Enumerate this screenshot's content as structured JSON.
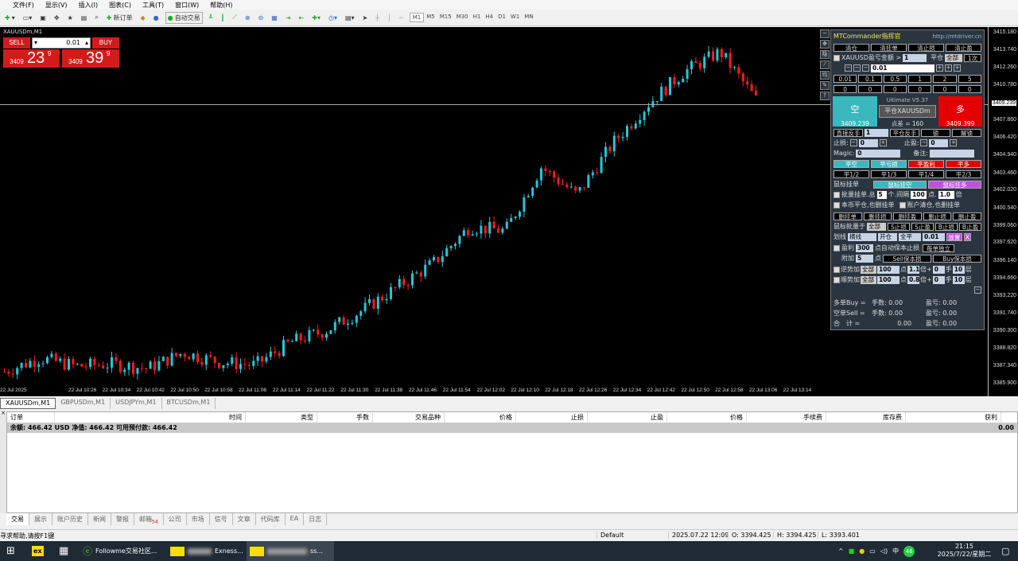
{
  "menu": [
    "文件(F)",
    "显示(V)",
    "插入(I)",
    "图表(C)",
    "工具(T)",
    "窗口(W)",
    "帮助(H)"
  ],
  "toolbar": {
    "new_order": "新订单",
    "auto_trade": "自动交易",
    "timeframes": [
      "M1",
      "M5",
      "M15",
      "M30",
      "H1",
      "H4",
      "D1",
      "W1",
      "MN"
    ]
  },
  "chart": {
    "title": "XAUUSDm,M1",
    "one_click": {
      "sell": "SELL",
      "buy": "BUY",
      "lot": "0.01",
      "sell_big": "3409",
      "sell_pips": "23",
      "sell_sup": "9",
      "buy_big": "3409",
      "buy_pips": "39",
      "buy_sup": "9"
    },
    "current_price": "3409.239",
    "price_labels": [
      "3415.180",
      "3413.740",
      "3412.260",
      "3410.780",
      "3407.860",
      "3406.420",
      "3404.940",
      "3403.460",
      "3402.020",
      "3400.540",
      "3399.060",
      "3397.620",
      "3396.140",
      "3394.660",
      "3393.220",
      "3391.740",
      "3390.300",
      "3388.820",
      "3387.340",
      "3385.900"
    ],
    "time_labels": [
      "22 Jul 2025",
      "22 Jul 10:26",
      "22 Jul 10:34",
      "22 Jul 10:42",
      "22 Jul 10:50",
      "22 Jul 10:58",
      "22 Jul 11:06",
      "22 Jul 11:14",
      "22 Jul 11:22",
      "22 Jul 11:30",
      "22 Jul 11:38",
      "22 Jul 11:46",
      "22 Jul 11:54",
      "22 Jul 12:02",
      "22 Jul 12:10",
      "22 Jul 12:18",
      "22 Jul 12:26",
      "22 Jul 12:34",
      "22 Jul 12:42",
      "22 Jul 12:50",
      "22 Jul 12:58",
      "22 Jul 13:06",
      "22 Jul 13:14"
    ]
  },
  "chart_data": {
    "type": "candlestick",
    "symbol": "XAUUSDm",
    "timeframe": "M1",
    "ylim": [
      3385.9,
      3415.18
    ],
    "price_path": [
      3386.96,
      3388.09,
      3387.42,
      3387.6,
      3387.22,
      3388.55,
      3387.76,
      3387.5,
      3389.42,
      3390.41,
      3392.07,
      3394.06,
      3396.05,
      3399.04,
      3398.71,
      3404.02,
      3401.7,
      3406.02,
      3409.34,
      3411.99,
      3413.65,
      3409.67
    ]
  },
  "panel": {
    "title": "MTCommander指挥官",
    "url": "http://mtdriver.cn",
    "row1": [
      "清仓",
      "清挂单",
      "清止损",
      "清止盈"
    ],
    "loss_label": "XAUUSD盈亏金额 >",
    "loss_val": "1",
    "close_label": "平仓",
    "close_sel": "全部",
    "times": "1次",
    "lot": "0.01",
    "lot_presets": [
      "0.01",
      "0.1",
      "0.5",
      "1",
      "2",
      "5"
    ],
    "zeros": [
      "0",
      "0",
      "0",
      "0",
      "0",
      "0"
    ],
    "version": "Ultimate V5.37",
    "sell_label": "空",
    "sell_price": "3409.239",
    "close_sym": "平仓XAUUSDm",
    "spread": "点差 = 160",
    "buy_label": "多",
    "buy_price": "3409.399",
    "reverse": "直接反手",
    "reverse_val": "1",
    "close_reverse": "平仓反手",
    "lock": "锁",
    "unlock": "解锁",
    "sl": "止损:",
    "sl_val": "0",
    "tp": "止盈:",
    "tp_val": "0",
    "magic": "Magic:",
    "magic_val": "0",
    "note": "备注:",
    "close_btns": [
      "平空",
      "平亏损",
      "平盈利",
      "平多"
    ],
    "part_btns": [
      "平1/2",
      "平1/3",
      "平1/4",
      "平2/3"
    ],
    "mouse_pending": "鼠标挂单",
    "mouse_sell": "鼠标挂空",
    "mouse_buy": "鼠标挂多",
    "batch": [
      "批量挂单.总",
      "5",
      "个.间隔",
      "100",
      "点.",
      "1.0",
      "倍"
    ],
    "opt1": "本币平仓,也删挂单",
    "opt2": "账户清仓,也删挂单",
    "del_btns": [
      "删挂单",
      "删挂损",
      "删挂盈",
      "删止损",
      "删止盈"
    ],
    "batch_mouse": "鼠标批量于",
    "all": "全部",
    "sl_tp_btns": [
      "S止损",
      "S止盈",
      "B止损",
      "B止盈"
    ],
    "line": "划线",
    "line_sel": "横线",
    "open_sel": "开仓",
    "close_all": "全平",
    "line_lot": "0.01",
    "place": "放置",
    "x": "X",
    "profit": "盈利",
    "profit_val": "300",
    "auto_be": "点自动保本止损",
    "each": "每单独立",
    "add": "附加",
    "add_val": "5",
    "pt": "点",
    "sell_be": "Sell保本损",
    "buy_be": "Buy保本损",
    "counter": "逆势加",
    "trend": "顺势加",
    "c_vals": [
      "100",
      "1.1",
      "0",
      "10"
    ],
    "t_vals": [
      "100",
      "0.8",
      "0",
      "10"
    ],
    "units": [
      "点",
      "倍+",
      "手",
      "层"
    ],
    "sum": [
      [
        "多单Buy =",
        "手数: 0.00",
        "盈亏: 0.00"
      ],
      [
        "空单Sell =",
        "手数: 0.00",
        "盈亏: 0.00"
      ],
      [
        "合　计 =",
        "0.00",
        "盈亏: 0.00"
      ]
    ]
  },
  "chart_tabs": [
    "XAUUSDm,M1",
    "GBPUSDm,M1",
    "USDJPYm,M1",
    "BTCUSDm,M1"
  ],
  "terminal": {
    "headers": [
      "订单",
      "时间",
      "类型",
      "手数",
      "交易品种",
      "价格",
      "止损",
      "止盈",
      "价格",
      "手续费",
      "库存费",
      "获利"
    ],
    "balance": "余额: 466.42 USD  净值: 466.42  可用预付款: 466.42",
    "profit": "0.00"
  },
  "bottom_tabs": [
    "交易",
    "展示",
    "账户历史",
    "新闻",
    "警报",
    "邮箱",
    "公司",
    "市场",
    "信号",
    "文章",
    "代码库",
    "EA",
    "日志"
  ],
  "mail_count": "54",
  "status": {
    "help": "寻求帮助,请按F1键",
    "profile": "Default",
    "time": "2025.07.22 12:09",
    "open": "O: 3394.425",
    "high": "H: 3394.425",
    "low": "L: 3393.401"
  },
  "taskbar": {
    "apps": [
      "Followme交易社区...",
      "Exness...",
      "ss..."
    ],
    "clock": "21:15",
    "date": "2025/7/22/星期二",
    "ime": "中",
    "badge": "46"
  }
}
